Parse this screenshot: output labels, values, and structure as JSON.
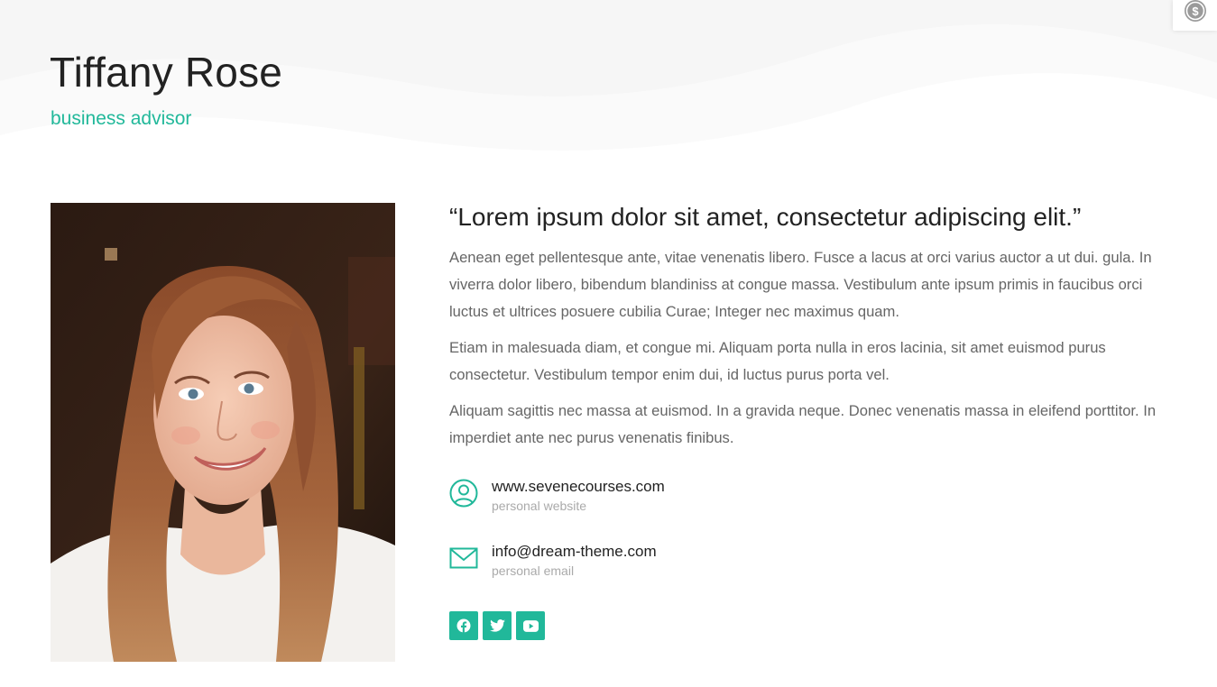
{
  "header": {
    "name": "Tiffany Rose",
    "role": "business advisor"
  },
  "profile": {
    "quote": "“Lorem ipsum dolor sit amet, consectetur adipiscing elit.”",
    "paragraphs": [
      "Aenean eget pellentesque ante, vitae venenatis libero. Fusce a lacus at orci varius auctor a ut dui. gula. In viverra dolor libero, bibendum blandiniss at congue massa. Vestibulum ante ipsum primis in faucibus orci luctus et ultrices posuere cubilia Curae; Integer nec maximus quam.",
      "Etiam in malesuada diam, et congue mi. Aliquam porta nulla in eros lacinia, sit amet euismod purus consectetur. Vestibulum tempor enim dui, id luctus purus porta vel.",
      "Aliquam sagittis nec massa at euismod. In a gravida neque. Donec venenatis massa in eleifend porttitor. In imperdiet ante nec purus venenatis finibus."
    ]
  },
  "contacts": [
    {
      "value": "www.sevenecourses.com",
      "label": "personal website",
      "icon": "user-circle-icon"
    },
    {
      "value": "info@dream-theme.com",
      "label": "personal email",
      "icon": "envelope-icon"
    }
  ],
  "socials": [
    {
      "icon": "facebook-icon"
    },
    {
      "icon": "twitter-icon"
    },
    {
      "icon": "youtube-icon"
    }
  ],
  "colors": {
    "accent": "#21b89a",
    "heading": "#222222",
    "body_text": "#666666",
    "muted_text": "#aaaaaa"
  }
}
